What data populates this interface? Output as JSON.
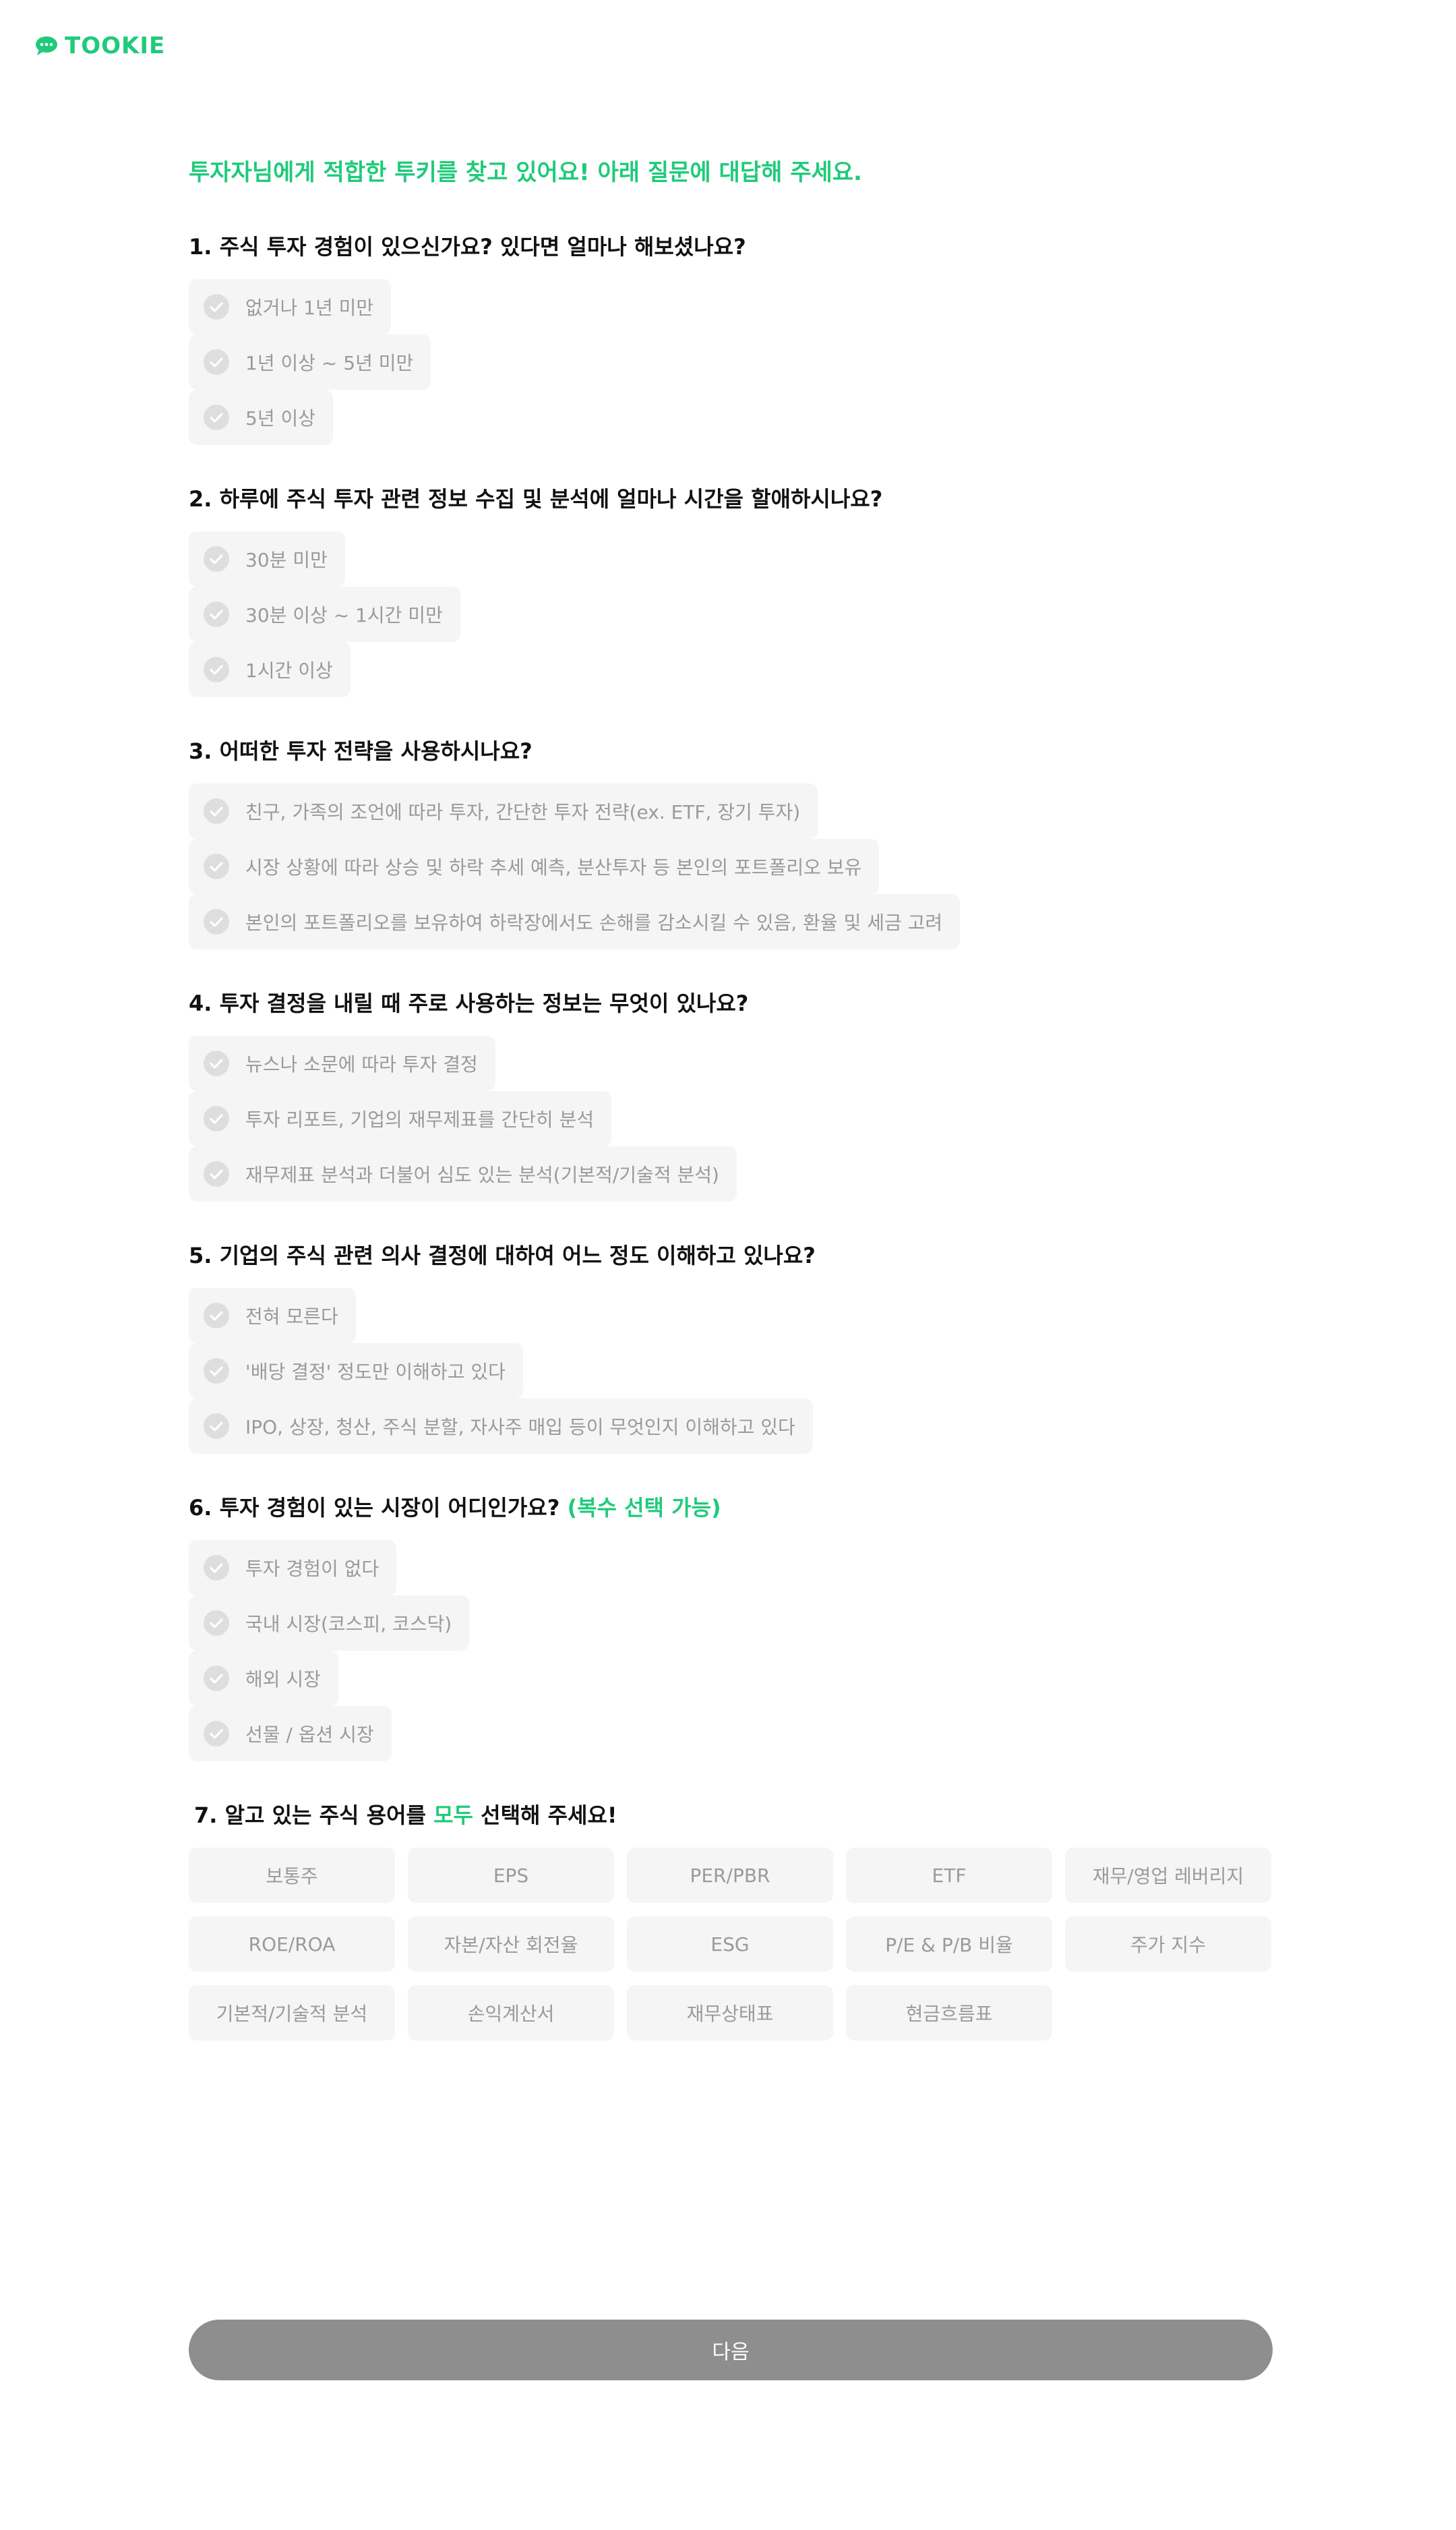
{
  "brand": {
    "name": "TOOKIE",
    "icon": "chat-bubble-icon",
    "color": "#1fcb7a"
  },
  "intro": "투자자님에게 적합한 투키를 찾고 있어요! 아래 질문에 대답해 주세요.",
  "questions": [
    {
      "title": "1. 주식 투자 경험이 있으신가요? 있다면 얼마나 해보셨나요?",
      "options": [
        "없거나 1년 미만",
        "1년 이상 ~ 5년 미만",
        "5년 이상"
      ]
    },
    {
      "title": "2. 하루에 주식 투자 관련 정보 수집 및 분석에 얼마나 시간을 할애하시나요?",
      "options": [
        "30분 미만",
        "30분 이상 ~ 1시간 미만",
        "1시간 이상"
      ]
    },
    {
      "title": "3. 어떠한 투자 전략을 사용하시나요?",
      "options": [
        "친구, 가족의 조언에 따라 투자, 간단한 투자 전략(ex. ETF, 장기 투자)",
        "시장 상황에 따라 상승 및 하락 추세 예측, 분산투자 등 본인의 포트폴리오 보유",
        "본인의 포트폴리오를 보유하여 하락장에서도 손해를 감소시킬 수 있음, 환율 및 세금 고려"
      ]
    },
    {
      "title": "4. 투자 결정을 내릴 때 주로 사용하는 정보는 무엇이 있나요?",
      "options": [
        "뉴스나 소문에 따라 투자 결정",
        "투자 리포트, 기업의 재무제표를 간단히 분석",
        "재무제표 분석과 더불어 심도 있는 분석(기본적/기술적 분석)"
      ]
    },
    {
      "title": "5. 기업의 주식 관련 의사 결정에 대하여 어느 정도 이해하고 있나요?",
      "options": [
        "전혀 모른다",
        "'배당 결정' 정도만 이해하고 있다",
        "IPO, 상장, 청산, 주식 분할, 자사주 매입 등이 무엇인지 이해하고 있다"
      ]
    },
    {
      "title": "6. 투자 경험이 있는 시장이 어디인가요?",
      "title_accent": "(복수 선택 가능)",
      "options": [
        "투자 경험이 없다",
        "국내 시장(코스피, 코스닥)",
        "해외 시장",
        "선물 / 옵션 시장"
      ]
    }
  ],
  "q7": {
    "prefix": "7. 알고 있는 주식 용어를 ",
    "accent": "모두",
    "suffix": " 선택해 주세요!",
    "terms": [
      "보통주",
      "EPS",
      "PER/PBR",
      "ETF",
      "재무/영업 레버리지",
      "ROE/ROA",
      "자본/자산 회전율",
      "ESG",
      "P/E & P/B 비율",
      "주가 지수",
      "기본적/기술적 분석",
      "손익계산서",
      "재무상태표",
      "현금흐름표"
    ]
  },
  "next_button": {
    "label": "다음"
  },
  "colors": {
    "accent": "#1fcb7a",
    "option_bg": "#f5f5f5",
    "option_text": "#9a9a9a",
    "check_bg": "#dedede",
    "button_bg": "#8e8e8e"
  },
  "icons": {
    "option_check": "check-circle-icon"
  }
}
